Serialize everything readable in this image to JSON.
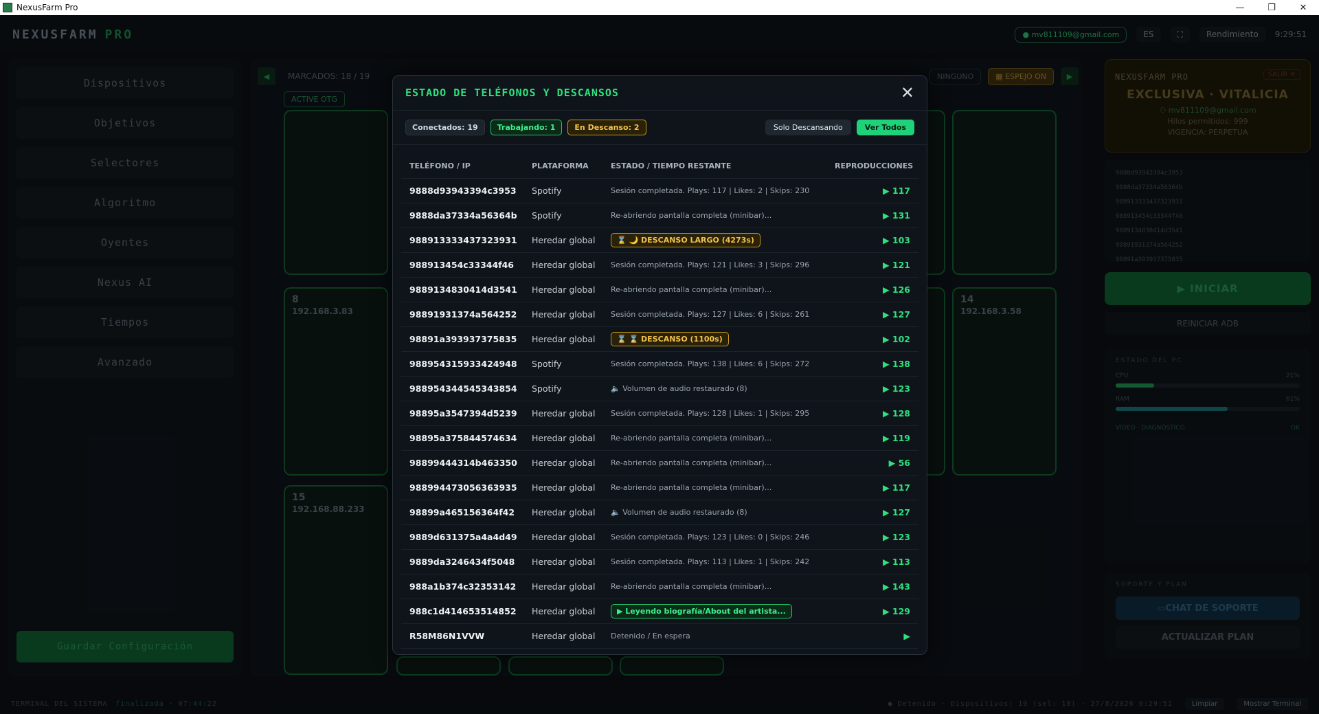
{
  "window": {
    "title": "NexusFarm Pro",
    "controls": [
      "—",
      "❐",
      "✕"
    ]
  },
  "header": {
    "brand": "NEXUSFARM",
    "brand_suffix": "PRO",
    "email": "mv811109@gmail.com",
    "lang": "ES",
    "fullscreen": "⛶",
    "performance": "Rendimiento",
    "clock": "9:29:51"
  },
  "sidebar": {
    "items": [
      "Dispositivos",
      "Objetivos",
      "Selectores",
      "Algoritmo",
      "Oyentes",
      "Nexus AI",
      "Tiempos",
      "Avanzado"
    ],
    "save_label": "Guardar Configuración"
  },
  "center": {
    "marked": "MARCADOS: 18 / 19",
    "ninguno": "NINGUNO",
    "espejo": "ESPEJO ON",
    "active_otg": "ACTIVE OTG",
    "phones": [
      {
        "num": "8",
        "ip": "192.168.3.83"
      },
      {
        "num": "14",
        "ip": "192.168.3.58"
      },
      {
        "num": "15",
        "ip": "192.168.88.233"
      }
    ]
  },
  "right": {
    "license_label": "NEXUSFARM PRO",
    "salir": "SALIR ✕",
    "license_type": "EXCLUSIVA · VITALICIA",
    "license_email": "mv811109@gmail.com",
    "threads": "Hilos permitidos: 999",
    "validity": "VIGENCIA: PERPETUA",
    "ids": [
      "9888d93943394c3953",
      "9888da37334a56364b",
      "988913333437323931",
      "988913454c33344f46",
      "9889134830414d3541",
      "98891931374a564252",
      "98891a393937375835"
    ],
    "start": "▶ INICIAR",
    "restart_adb": "REINICIAR ADB",
    "pc_state": "ESTADO DEL PC",
    "cpu_label": "CPU",
    "cpu_value": "21%",
    "cpu_level": 0.21,
    "ram_label": "RAM",
    "ram_value": "61%",
    "ram_level": 0.61,
    "video_label": "VÍDEO · DIAGNÓSTICO",
    "video_status": "OK",
    "support_title": "SOPORTE Y PLAN",
    "chat": "CHAT DE SOPORTE",
    "update_plan": "ACTUALIZAR PLAN"
  },
  "terminal": {
    "label": "TERMINAL DEL SISTEMA",
    "finalized": "finalizada · 07:44:22",
    "status": "● Detenido · Dispositivos: 19 (sel: 18) · 27/8/2026 9:29:51",
    "clear": "Limpiar",
    "show": "Mostrar Terminal"
  },
  "modal": {
    "title": "ESTADO DE TELÉFONOS Y DESCANSOS",
    "close": "✕",
    "stats": {
      "connected": "Conectados: 19",
      "working": "Trabajando: 1",
      "resting": "En Descanso: 2"
    },
    "filter_rest": "Solo Descansando",
    "filter_all": "Ver Todos",
    "columns": [
      "TELÉFONO / IP",
      "PLATAFORMA",
      "ESTADO / TIEMPO RESTANTE",
      "REPRODUCCIONES"
    ],
    "rows": [
      {
        "phone": "9888d93943394c3953",
        "platform": "Spotify",
        "status": "Sesión completada. Plays: 117 | Likes: 2 | Skips: 230",
        "kind": "text",
        "plays": "▶ 117"
      },
      {
        "phone": "9888da37334a56364b",
        "platform": "Spotify",
        "status": "Re-abriendo pantalla completa (minibar)...",
        "kind": "text",
        "plays": "▶ 131"
      },
      {
        "phone": "988913333437323931",
        "platform": "Heredar global",
        "status": "⌛ 🌙 DESCANSO LARGO (4273s)",
        "kind": "rest",
        "plays": "▶ 103"
      },
      {
        "phone": "988913454c33344f46",
        "platform": "Heredar global",
        "status": "Sesión completada. Plays: 121 | Likes: 3 | Skips: 296",
        "kind": "text",
        "plays": "▶ 121"
      },
      {
        "phone": "9889134830414d3541",
        "platform": "Heredar global",
        "status": "Re-abriendo pantalla completa (minibar)...",
        "kind": "text",
        "plays": "▶ 126"
      },
      {
        "phone": "98891931374a564252",
        "platform": "Heredar global",
        "status": "Sesión completada. Plays: 127 | Likes: 6 | Skips: 261",
        "kind": "text",
        "plays": "▶ 127"
      },
      {
        "phone": "98891a393937375835",
        "platform": "Heredar global",
        "status": "⌛ ⌛ DESCANSO (1100s)",
        "kind": "rest",
        "plays": "▶ 102"
      },
      {
        "phone": "988954315933424948",
        "platform": "Spotify",
        "status": "Sesión completada. Plays: 138 | Likes: 6 | Skips: 272",
        "kind": "text",
        "plays": "▶ 138"
      },
      {
        "phone": "988954344545343854",
        "platform": "Spotify",
        "status": "🔈 Volumen de audio restaurado (8)",
        "kind": "text",
        "plays": "▶ 123"
      },
      {
        "phone": "98895a3547394d5239",
        "platform": "Heredar global",
        "status": "Sesión completada. Plays: 128 | Likes: 1 | Skips: 295",
        "kind": "text",
        "plays": "▶ 128"
      },
      {
        "phone": "98895a375844574634",
        "platform": "Heredar global",
        "status": "Re-abriendo pantalla completa (minibar)...",
        "kind": "text",
        "plays": "▶ 119"
      },
      {
        "phone": "98899444314b463350",
        "platform": "Heredar global",
        "status": "Re-abriendo pantalla completa (minibar)...",
        "kind": "text",
        "plays": "▶ 56"
      },
      {
        "phone": "988994473056363935",
        "platform": "Heredar global",
        "status": "Re-abriendo pantalla completa (minibar)...",
        "kind": "text",
        "plays": "▶ 117"
      },
      {
        "phone": "98899a465156364f42",
        "platform": "Heredar global",
        "status": "🔈 Volumen de audio restaurado (8)",
        "kind": "text",
        "plays": "▶ 127"
      },
      {
        "phone": "9889d631375a4a4d49",
        "platform": "Heredar global",
        "status": "Sesión completada. Plays: 123 | Likes: 0 | Skips: 246",
        "kind": "text",
        "plays": "▶ 123"
      },
      {
        "phone": "9889da3246434f5048",
        "platform": "Heredar global",
        "status": "Sesión completada. Plays: 113 | Likes: 1 | Skips: 242",
        "kind": "text",
        "plays": "▶ 113"
      },
      {
        "phone": "988a1b374c32353142",
        "platform": "Heredar global",
        "status": "Re-abriendo pantalla completa (minibar)...",
        "kind": "text",
        "plays": "▶ 143"
      },
      {
        "phone": "988c1d414653514852",
        "platform": "Heredar global",
        "status": "▶ Leyendo biografía/About del artista...",
        "kind": "work",
        "plays": "▶ 129"
      },
      {
        "phone": "R58M86N1VVW",
        "platform": "Heredar global",
        "status": "Detenido / En espera",
        "kind": "text",
        "plays": "▶"
      }
    ]
  }
}
